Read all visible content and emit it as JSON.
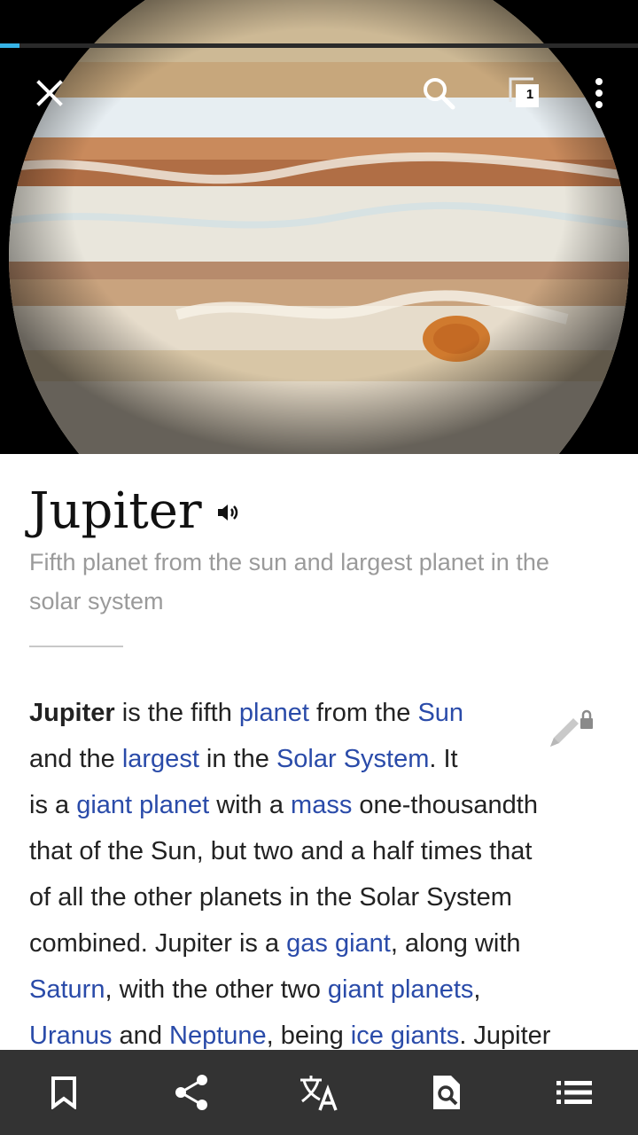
{
  "header": {
    "image_alt": "Jupiter",
    "load_progress": 0.03,
    "tab_count": "1"
  },
  "article": {
    "title": "Jupiter",
    "description": "Fifth planet from the sun and largest planet in the solar system",
    "lines": [
      [
        {
          "t": "Jupiter",
          "b": true
        },
        {
          "t": " is the fifth "
        },
        {
          "t": "planet",
          "link": true
        },
        {
          "t": " from the "
        },
        {
          "t": "Sun",
          "link": true
        }
      ],
      [
        {
          "t": "and the "
        },
        {
          "t": "largest",
          "link": true
        },
        {
          "t": " in the "
        },
        {
          "t": "Solar System",
          "link": true
        },
        {
          "t": ". It"
        }
      ],
      [
        {
          "t": "is a "
        },
        {
          "t": "giant planet",
          "link": true
        },
        {
          "t": " with a "
        },
        {
          "t": "mass",
          "link": true
        },
        {
          "t": " one-thousandth"
        }
      ],
      [
        {
          "t": "that of the Sun, but two and a half times that"
        }
      ],
      [
        {
          "t": "of all the other planets in the Solar System"
        }
      ],
      [
        {
          "t": "combined. Jupiter is a "
        },
        {
          "t": "gas giant",
          "link": true
        },
        {
          "t": ", along with"
        }
      ],
      [
        {
          "t": "Saturn",
          "link": true
        },
        {
          "t": ", with the other two "
        },
        {
          "t": "giant planets",
          "link": true
        },
        {
          "t": ","
        }
      ],
      [
        {
          "t": "Uranus",
          "link": true
        },
        {
          "t": " and "
        },
        {
          "t": "Neptune",
          "link": true
        },
        {
          "t": ", being "
        },
        {
          "t": "ice giants",
          "link": true
        },
        {
          "t": ". Jupiter"
        }
      ]
    ]
  },
  "icons": {
    "close": "close-icon",
    "search": "search-icon",
    "tabs": "tabs-icon",
    "overflow": "overflow-menu-icon",
    "audio": "speaker-icon",
    "edit": "edit-locked-icon",
    "bottom": [
      "bookmark-icon",
      "share-icon",
      "translate-icon",
      "find-in-page-icon",
      "table-of-contents-icon"
    ]
  },
  "colors": {
    "link": "#2a4ba9",
    "progress": "#36b3e6",
    "toolbar": "#333333"
  }
}
